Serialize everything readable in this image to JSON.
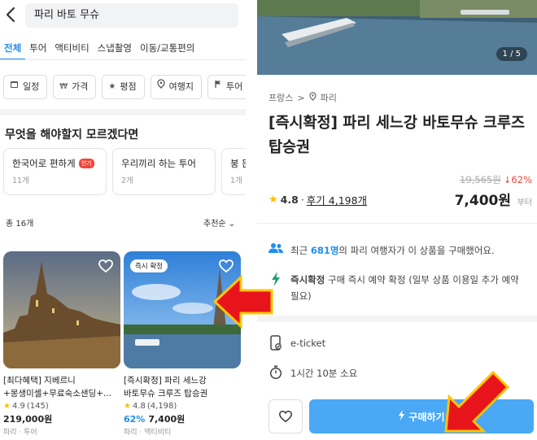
{
  "left": {
    "search": {
      "value": "파리 바토 무슈"
    },
    "tabs": [
      "전체",
      "투어",
      "액티비티",
      "스냅촬영",
      "이동/교통편의"
    ],
    "filters": [
      {
        "icon": "calendar-icon",
        "label": "일정"
      },
      {
        "icon": "won-icon",
        "label": "가격"
      },
      {
        "icon": "star-icon",
        "label": "평점"
      },
      {
        "icon": "location-icon",
        "label": "여행지"
      },
      {
        "icon": "flag-icon",
        "label": "투어"
      }
    ],
    "question": "무엇을 해야할지 모르겠다면",
    "quick": [
      {
        "title": "한국어로 편하게",
        "badge": "인기",
        "sub": "11개"
      },
      {
        "title": "우리끼리 하는 투어",
        "badge": "",
        "sub": "2개"
      },
      {
        "title": "붕 뜬 시",
        "badge": "",
        "sub": "1개"
      }
    ],
    "total": "총 16개",
    "sort": "추천순",
    "products": [
      {
        "badge": "",
        "line1": "[최다혜택] 지베르니",
        "line2": "+몽생미셸+무료숙소샌딩+...",
        "rating": "4.9",
        "reviews": "(145)",
        "discount": "",
        "price": "219,000원",
        "sub": "파리 · 투어"
      },
      {
        "badge": "즉시 확정",
        "line1": "[즉시확정] 파리 세느강",
        "line2": "바토무슈 크루즈 탑승권",
        "rating": "4.8",
        "reviews": "(4,198)",
        "discount": "62%",
        "price": "7,400원",
        "sub": "파리 · 액티비티"
      }
    ]
  },
  "right": {
    "pager": "1 / 5",
    "crumb_country": "프랑스",
    "crumb_sep": ">",
    "crumb_city": "파리",
    "title": "[즉시확정] 파리 세느강 바토무슈 크루즈 탑승권",
    "original_price": "19,565원",
    "discount": "↓62%",
    "rating": "4.8",
    "reviews_sep": "·",
    "reviews": "후기 4,198개",
    "price": "7,400원",
    "from": "부터",
    "buyers_prefix": "최근",
    "buyers_count": "681명",
    "buyers_suffix": "의 파리 여행자가 이 상품을 구매했어요.",
    "instant_title": "즉시확정",
    "instant_desc": "구매 즉시 예약 확정 (일부 상품 이용일 추가 예약 필요)",
    "ticket": "e-ticket",
    "duration": "1시간 10분 소요",
    "buy": "구매하기"
  },
  "colors": {
    "accent": "#1f8ef1",
    "button": "#4aa8f5",
    "sale": "#f0453b",
    "arrow": "#e8141b"
  }
}
